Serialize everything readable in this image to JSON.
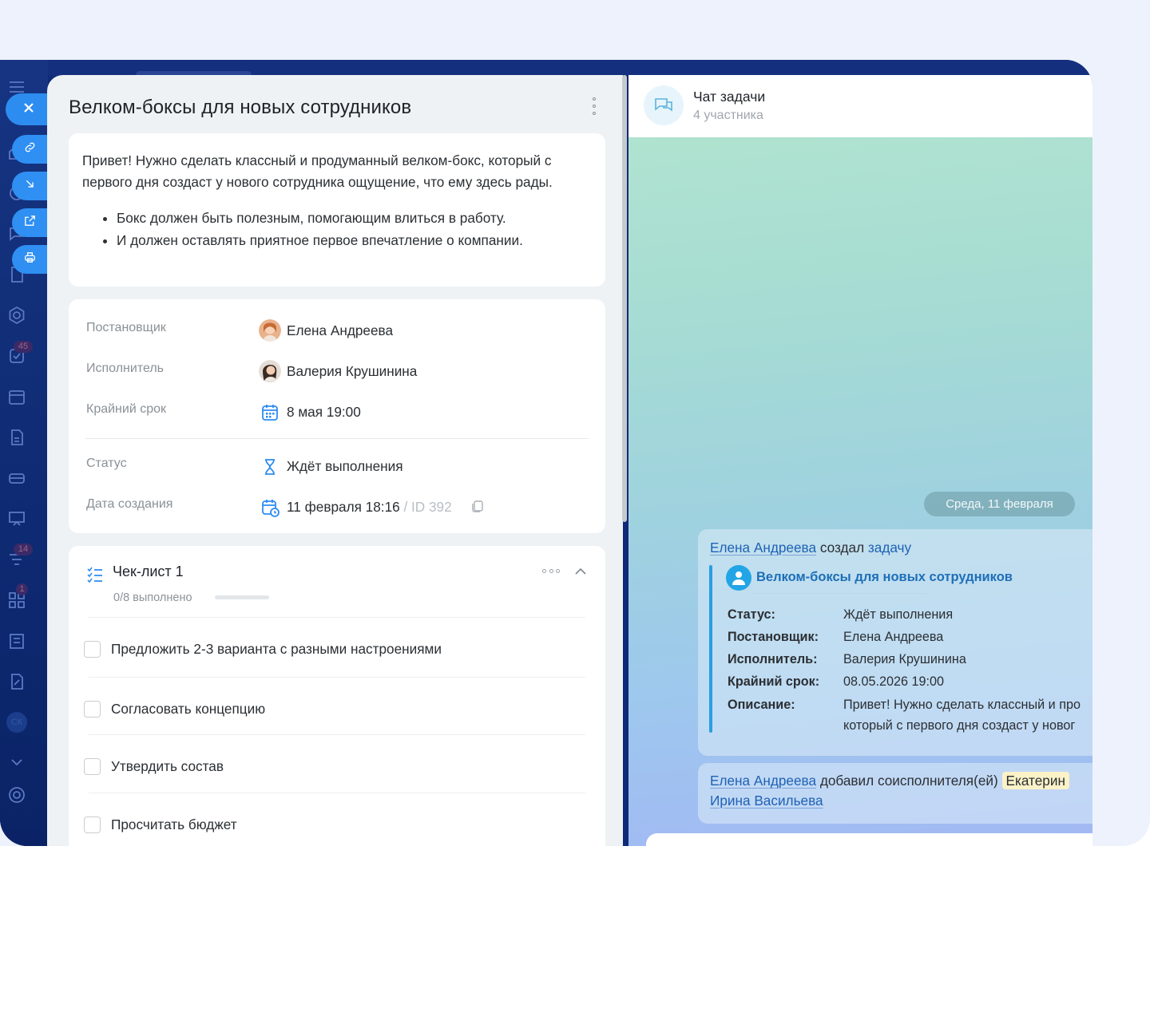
{
  "task": {
    "title": "Велком-боксы для новых сотрудников",
    "description": {
      "intro": "Привет! Нужно сделать классный и продуманный велком-бокс, который с первого дня создаст у нового сотрудника ощущение, что ему здесь рады.",
      "bullets": [
        "Бокс должен быть полезным, помогающим влиться в работу.",
        "И должен оставлять приятное первое впечатление о компании."
      ]
    },
    "properties": {
      "creator": {
        "label": "Постановщик",
        "value": "Елена Андреева"
      },
      "assignee": {
        "label": "Исполнитель",
        "value": "Валерия Крушинина"
      },
      "deadline": {
        "label": "Крайний срок",
        "value": "8 мая 19:00"
      },
      "status": {
        "label": "Статус",
        "value": "Ждёт выполнения"
      },
      "created": {
        "label": "Дата создания",
        "value": "11 февраля 18:16",
        "id_sep": "/",
        "id": "ID 392"
      }
    },
    "checklist": {
      "title": "Чек-лист 1",
      "progress_text": "0/8 выполнено",
      "progress": 0,
      "items": [
        "Предложить 2-3 варианта с разными настроениями",
        "Согласовать концепцию",
        "Утвердить состав",
        "Просчитать бюджет"
      ]
    }
  },
  "nav": {
    "badges": [
      "45",
      "14",
      "1"
    ],
    "avatar_initials": "СК",
    "icons": [
      "menu-icon",
      "home-icon",
      "feed-icon",
      "chat-icon",
      "document-icon",
      "settings-hex-icon",
      "tasks-icon",
      "calendar-icon",
      "page-icon",
      "crm-icon",
      "presentation-icon",
      "filter-icon",
      "grid-icon",
      "building-icon",
      "edit-doc-icon",
      "chevron-down-icon",
      "gear-icon"
    ]
  },
  "actions": [
    "close-icon",
    "link-icon",
    "download-icon",
    "external-link-icon",
    "print-icon"
  ],
  "chat": {
    "title": "Чат задачи",
    "subtitle": "4 участника",
    "date_divider": "Среда, 11 февраля",
    "message1": {
      "author": "Елена Андреева",
      "verb": "создал",
      "object": "задачу",
      "card_title": "Велком-боксы для новых сотрудников",
      "rows": [
        {
          "k": "Статус:",
          "v": "Ждёт выполнения"
        },
        {
          "k": "Постановщик:",
          "v": "Елена Андреева"
        },
        {
          "k": "Исполнитель:",
          "v": "Валерия Крушинина"
        },
        {
          "k": "Крайний срок:",
          "v": "08.05.2026 19:00"
        }
      ],
      "description_key": "Описание:",
      "description_line1": "Привет! Нужно сделать классный и про",
      "description_line2": "который с первого дня создаст у новог"
    },
    "message2": {
      "author": "Елена Андреева",
      "text": "добавил соисполнителя(ей)",
      "mention": "Екатерин",
      "second": "Ирина Васильева"
    }
  },
  "colors": {
    "accent": "#2d8cf0",
    "nav_bg": "#0f2a78",
    "link": "#1e62b5"
  }
}
